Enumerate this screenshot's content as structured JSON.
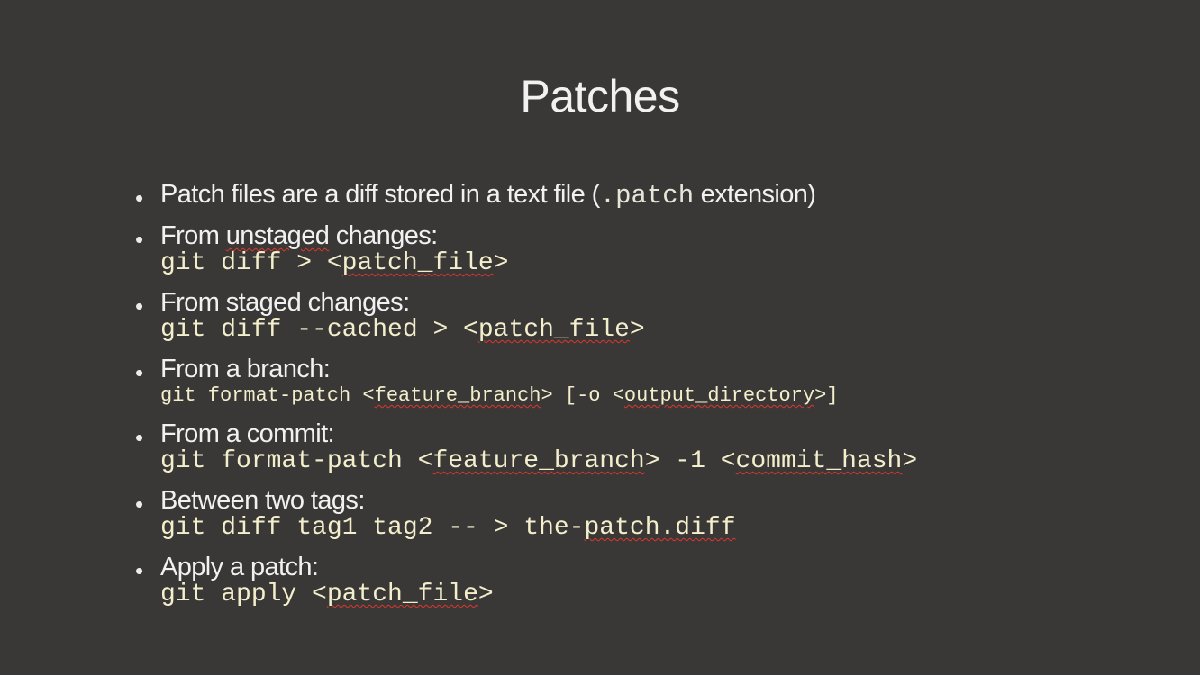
{
  "slide": {
    "title": "Patches",
    "bullets": [
      {
        "text_before": "Patch files are a diff stored in a text file (",
        "inline_code": ".patch",
        "text_after": " extension)"
      },
      {
        "label_part1": "From ",
        "label_squiggle": "unstaged",
        "label_part2": " changes:",
        "code_part1": "git diff > <",
        "code_squiggle": "patch_file",
        "code_part2": ">"
      },
      {
        "label": "From staged changes:",
        "code_part1": "git diff --cached > <",
        "code_squiggle": "patch_file",
        "code_part2": ">"
      },
      {
        "label": "From a branch:",
        "code_part1": "git format-patch <",
        "code_squiggle1": "feature_branch",
        "code_part2": "> [-o <",
        "code_squiggle2": "output_directory",
        "code_part3": ">]"
      },
      {
        "label": "From a commit:",
        "code_part1": "git format-patch <",
        "code_squiggle1": "feature_branch",
        "code_part2": "> -1 <",
        "code_squiggle2": "commit_hash",
        "code_part3": ">"
      },
      {
        "label": "Between two tags:",
        "code_part1": "git diff tag1 tag2 -- > the-",
        "code_squiggle": "patch.diff"
      },
      {
        "label": "Apply a patch:",
        "code_part1": "git apply <",
        "code_squiggle": "patch_file",
        "code_part2": ">"
      }
    ]
  },
  "colors": {
    "background": "#3a3837",
    "text": "#f1f1f1",
    "code": "#f3eecb",
    "spellcheck": "#e0352b"
  }
}
